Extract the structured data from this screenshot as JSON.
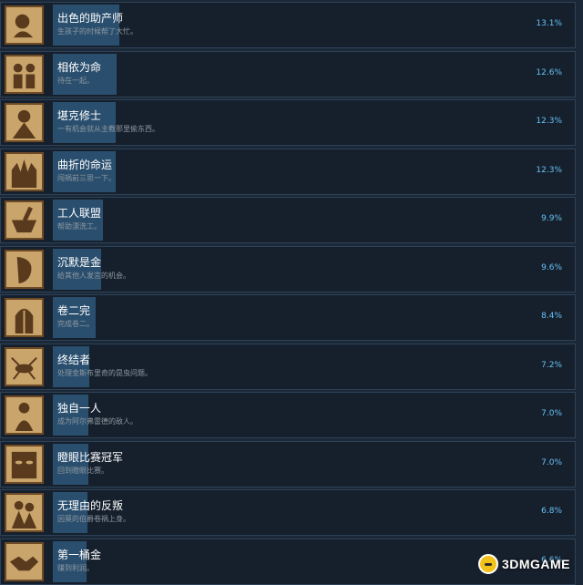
{
  "achievements": [
    {
      "title": "出色的助产师",
      "desc": "生孩子的时候帮了大忙。",
      "pct": "13.1%",
      "pct_value": 13.1,
      "icon": "baby-icon"
    },
    {
      "title": "相依为命",
      "desc": "待在一起。",
      "pct": "12.6%",
      "pct_value": 12.6,
      "icon": "couple-icon"
    },
    {
      "title": "堪克修士",
      "desc": "一有机会就从主教那里偷东西。",
      "pct": "12.3%",
      "pct_value": 12.3,
      "icon": "monk-icon"
    },
    {
      "title": "曲折的命运",
      "desc": "闯祸前三思一下。",
      "pct": "12.3%",
      "pct_value": 12.3,
      "icon": "burning-castle-icon"
    },
    {
      "title": "工人联盟",
      "desc": "帮助漂洗工。",
      "pct": "9.9%",
      "pct_value": 9.9,
      "icon": "mortar-pestle-icon"
    },
    {
      "title": "沉默是金",
      "desc": "给其他人发言的机会。",
      "pct": "9.6%",
      "pct_value": 9.6,
      "icon": "silent-face-icon"
    },
    {
      "title": "卷二完",
      "desc": "完成卷二。",
      "pct": "8.4%",
      "pct_value": 8.4,
      "icon": "cathedral-window-icon"
    },
    {
      "title": "终结者",
      "desc": "处理金斯布里奇的昆虫问题。",
      "pct": "7.2%",
      "pct_value": 7.2,
      "icon": "insect-icon"
    },
    {
      "title": "独自一人",
      "desc": "成为阿尔弗雷德的敌人。",
      "pct": "7.0%",
      "pct_value": 7.0,
      "icon": "lone-figure-icon"
    },
    {
      "title": "瞪眼比赛冠军",
      "desc": "回到瞪眼比赛。",
      "pct": "7.0%",
      "pct_value": 7.0,
      "icon": "staring-eyes-icon"
    },
    {
      "title": "无理由的反叛",
      "desc": "因莫的伯爵卷祸上身。",
      "pct": "6.8%",
      "pct_value": 6.8,
      "icon": "rebel-figures-icon"
    },
    {
      "title": "第一桶金",
      "desc": "赚到利润。",
      "pct": "6.6%",
      "pct_value": 6.6,
      "icon": "handshake-icon"
    }
  ],
  "colors": {
    "accent": "#66c0f4",
    "bar": "#2a4f6e",
    "row_bg": "#16202d",
    "icon_bg": "#c9a56b"
  },
  "watermark": {
    "text": "3DMGAME"
  }
}
